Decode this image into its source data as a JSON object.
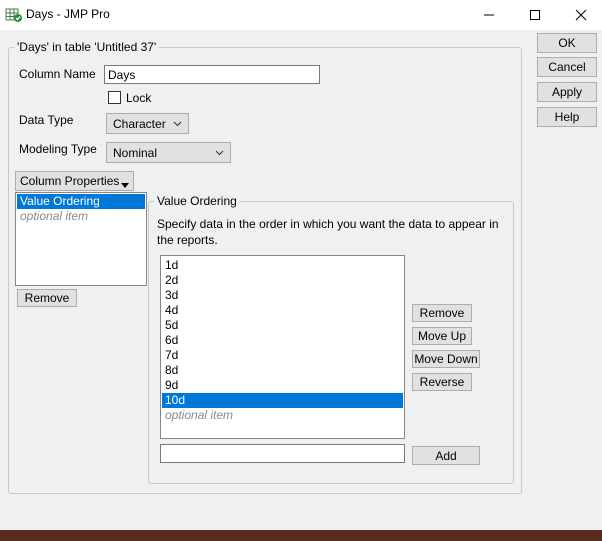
{
  "window": {
    "title": "Days - JMP Pro"
  },
  "dialog": {
    "legend": "'Days' in table 'Untitled 37'",
    "column_name_label": "Column Name",
    "column_name_value": "Days",
    "lock_label": "Lock",
    "lock_checked": false,
    "data_type_label": "Data Type",
    "data_type_value": "Character",
    "modeling_type_label": "Modeling Type",
    "modeling_type_value": "Nominal",
    "column_properties_label": "Column Properties",
    "properties_list": [
      {
        "label": "Value Ordering",
        "selected": true
      },
      {
        "label": "optional item",
        "optional": true
      }
    ],
    "remove_label": "Remove"
  },
  "side_buttons": {
    "ok": "OK",
    "cancel": "Cancel",
    "apply": "Apply",
    "help": "Help"
  },
  "value_ordering": {
    "title": "Value Ordering",
    "description": "Specify data in the order in which you want the data to appear in the reports.",
    "values": [
      "1d",
      "2d",
      "3d",
      "4d",
      "5d",
      "6d",
      "7d",
      "8d",
      "9d",
      "10d"
    ],
    "selected_value": "10d",
    "optional_item": "optional item",
    "buttons": {
      "remove": "Remove",
      "move_up": "Move Up",
      "move_down": "Move Down",
      "reverse": "Reverse",
      "add": "Add"
    },
    "add_input_value": ""
  },
  "colors": {
    "selection": "#0078d7",
    "window_bg": "#f0f0f0",
    "icon_green": "#2e8b3e"
  }
}
